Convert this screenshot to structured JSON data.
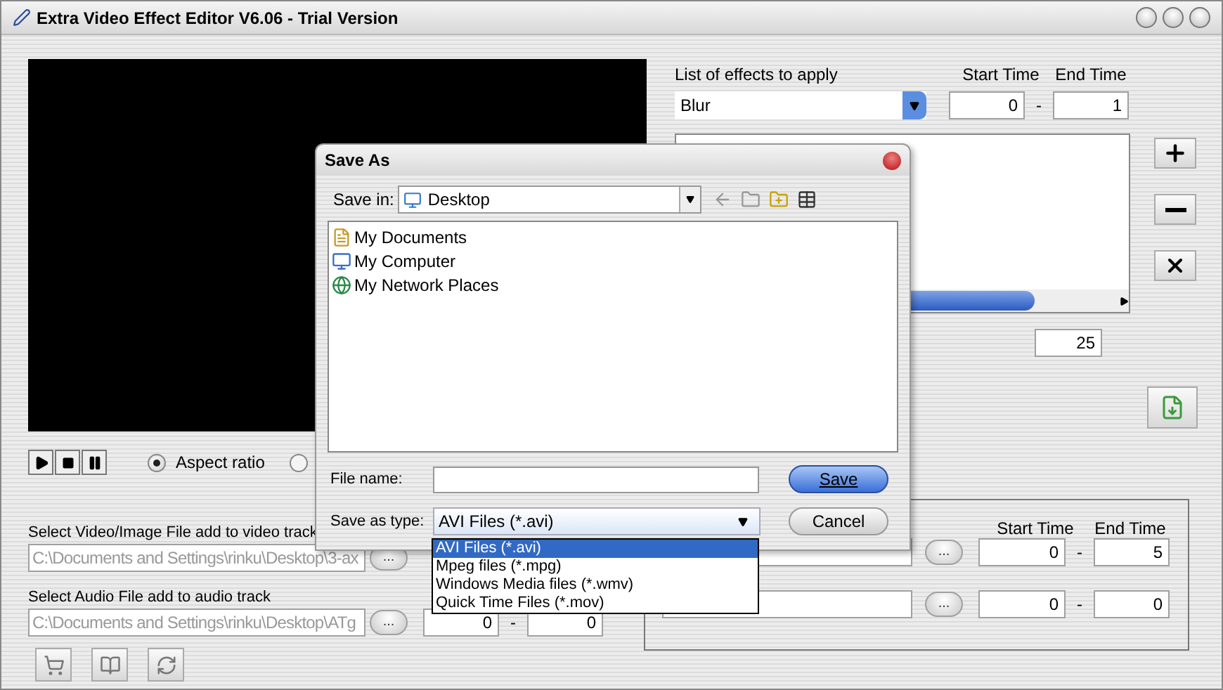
{
  "window": {
    "title": "Extra Video Effect Editor V6.06 - Trial Version"
  },
  "effects": {
    "label": "List of effects to apply",
    "start_label": "Start Time",
    "end_label": "End Time",
    "effect": "Blur",
    "start": "0",
    "separator": "-",
    "end": "1",
    "value": "25"
  },
  "playback": {
    "aspect_ratio": {
      "label": "Aspect ratio",
      "selected": true
    },
    "other_option": {
      "selected": false
    }
  },
  "video_track": {
    "label": "Select Video/Image File add to video track",
    "path": "C:\\Documents and Settings\\rinku\\Desktop\\3-ax",
    "browse": "..."
  },
  "audio_track": {
    "label": "Select Audio File add to audio track",
    "path": "C:\\Documents and Settings\\rinku\\Desktop\\ATg",
    "browse": "...",
    "start": "0",
    "separator": "-",
    "end": "0"
  },
  "overlay_track": {
    "start_label": "Start Time",
    "end_label": "End Time",
    "rows": [
      {
        "browse": "...",
        "start": "0",
        "separator": "-",
        "end": "5"
      },
      {
        "browse": "...",
        "start": "0",
        "separator": "-",
        "end": "0"
      }
    ]
  },
  "save_dialog": {
    "title": "Save As",
    "save_in_label": "Save in:",
    "save_in": "Desktop",
    "items": [
      {
        "label": "My Documents",
        "kind": "documents"
      },
      {
        "label": "My Computer",
        "kind": "computer"
      },
      {
        "label": "My Network Places",
        "kind": "network"
      }
    ],
    "file_name_label": "File name:",
    "save_as_type_label": "Save as type:",
    "save_as_type": "AVI Files (*.avi)",
    "type_options": [
      {
        "label": "AVI Files (*.avi)",
        "selected": true
      },
      {
        "label": "Mpeg files (*.mpg)",
        "selected": false
      },
      {
        "label": "Windows Media files (*.wmv)",
        "selected": false
      },
      {
        "label": "Quick Time Files (*.mov)",
        "selected": false
      }
    ],
    "save_button": "Save",
    "cancel_button": "Cancel"
  }
}
